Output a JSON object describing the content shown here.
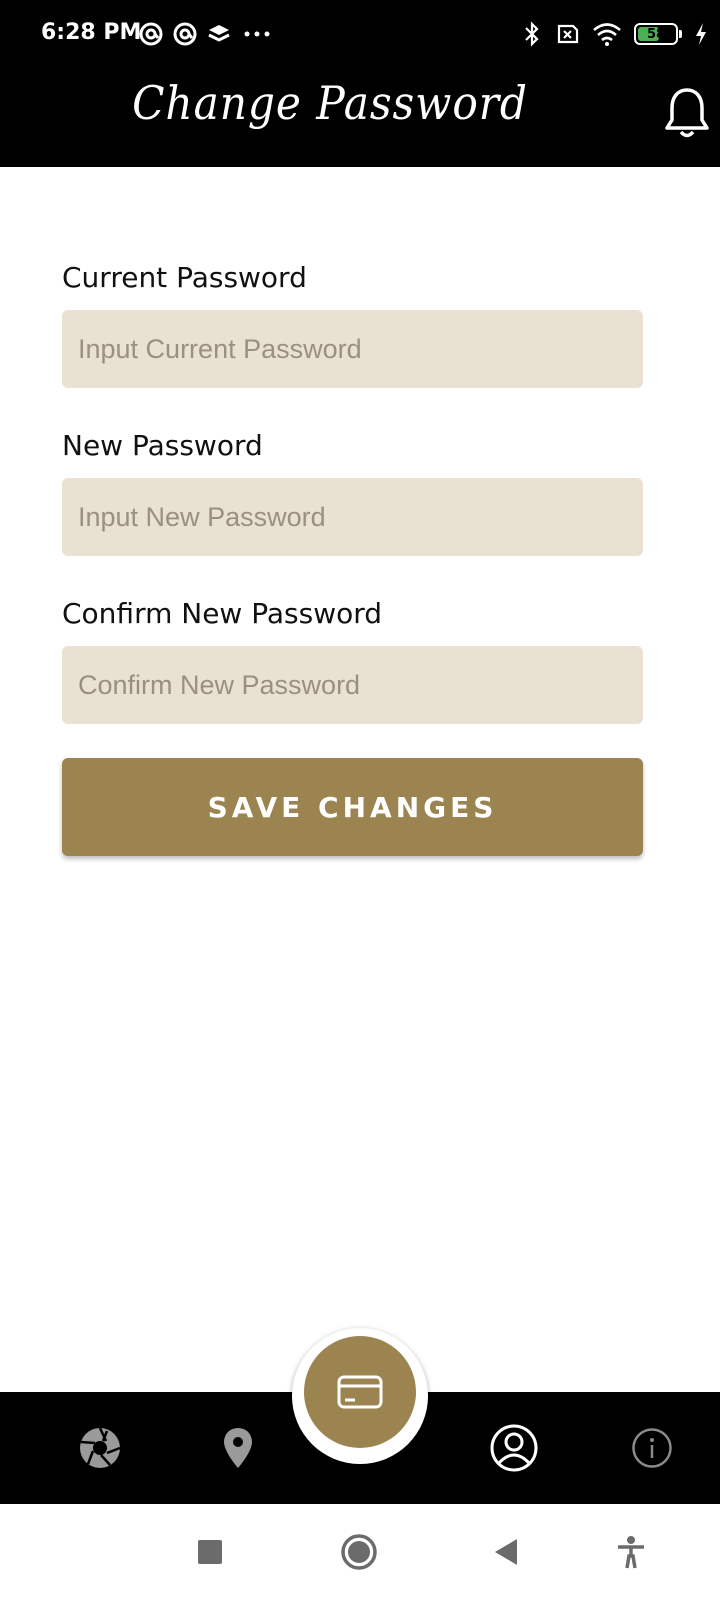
{
  "status_bar": {
    "time": "6:28 PM",
    "left_icons": [
      "at-sign-icon",
      "at-sign-icon",
      "layers-icon",
      "more-dots-icon"
    ],
    "battery_level": "58",
    "battery_fraction": 0.58,
    "right_icons": [
      "bluetooth-icon",
      "no-sim-icon",
      "wifi-icon",
      "battery-icon",
      "charging-icon"
    ]
  },
  "header": {
    "title": "Change Password",
    "notification_icon": "bell-icon"
  },
  "form": {
    "current_password": {
      "label": "Current Password",
      "placeholder": "Input Current Password",
      "value": ""
    },
    "new_password": {
      "label": "New Password",
      "placeholder": "Input New Password",
      "value": ""
    },
    "confirm_password": {
      "label": "Confirm New Password",
      "placeholder": "Confirm New Password",
      "value": ""
    },
    "save_label": "SAVE CHANGES"
  },
  "bottom_nav": {
    "items": [
      {
        "icon": "aperture-icon",
        "active": false
      },
      {
        "icon": "location-pin-icon",
        "active": false
      },
      {
        "icon": "card-icon",
        "active": false,
        "center": true
      },
      {
        "icon": "profile-icon",
        "active": true
      },
      {
        "icon": "info-icon",
        "active": false
      }
    ]
  },
  "system_nav": {
    "icons": [
      "stop-icon",
      "home-icon",
      "back-icon",
      "accessibility-icon"
    ]
  },
  "colors": {
    "accent": "#9c8450",
    "input_bg": "#e9e2d3",
    "header_bg": "#000000"
  }
}
